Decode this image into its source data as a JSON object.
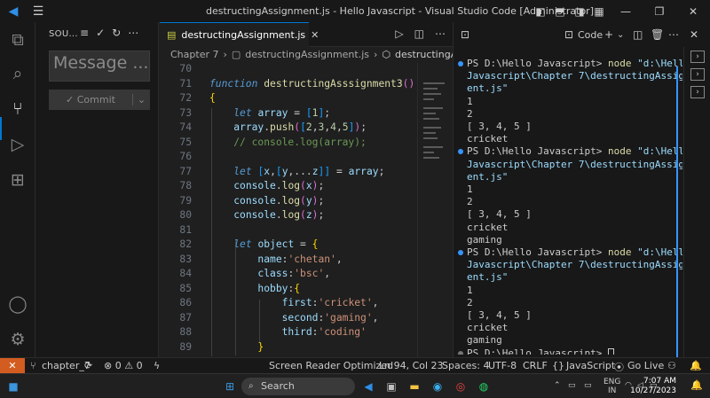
{
  "window": {
    "title": "destructingAssignment.js - Hello Javascript - Visual Studio Code [Administrator]"
  },
  "sidebar": {
    "header": "SOU...",
    "message_placeholder": "Message ...",
    "commit_label": "✓ Commit"
  },
  "editor": {
    "tab_label": "destructingAssignment.js",
    "breadcrumb": [
      "Chapter 7",
      "destructingAssignment.js",
      "destructingAsssignm"
    ],
    "line_numbers": [
      "70",
      "71",
      "72",
      "73",
      "74",
      "75",
      "76",
      "77",
      "78",
      "79",
      "80",
      "81",
      "82",
      "83",
      "84",
      "85",
      "86",
      "87",
      "88",
      "89"
    ],
    "code": [
      "",
      "function destructingAsssignment3()",
      "{",
      "    let array = [1];",
      "    array.push([2,3,4,5]);",
      "    // console.log(array);",
      "",
      "    let [x,[y,...z]] = array;",
      "    console.log(x);",
      "    console.log(y);",
      "    console.log(z);",
      "",
      "    let object = {",
      "        name:'chetan',",
      "        class:'bsc',",
      "        hobby:{",
      "            first:'cricket',",
      "            second:'gaming',",
      "            third:'coding'",
      "        }"
    ]
  },
  "terminal": {
    "shell_label": "Code",
    "output": [
      {
        "type": "cmd",
        "prompt": "PS D:\\Hello Javascript> ",
        "cmd": "node",
        "arg": " \"d:\\Hello"
      },
      {
        "type": "cont",
        "text": "Javascript\\Chapter 7\\destructingAssignm"
      },
      {
        "type": "cont",
        "text": "ent.js\""
      },
      {
        "type": "out",
        "text": "1"
      },
      {
        "type": "out",
        "text": "2"
      },
      {
        "type": "out",
        "text": "[ 3, 4, 5 ]"
      },
      {
        "type": "out",
        "text": "cricket"
      },
      {
        "type": "cmd",
        "prompt": "PS D:\\Hello Javascript> ",
        "cmd": "node",
        "arg": " \"d:\\Hello"
      },
      {
        "type": "cont",
        "text": "Javascript\\Chapter 7\\destructingAssignm"
      },
      {
        "type": "cont",
        "text": "ent.js\""
      },
      {
        "type": "out",
        "text": "1"
      },
      {
        "type": "out",
        "text": "2"
      },
      {
        "type": "out",
        "text": "[ 3, 4, 5 ]"
      },
      {
        "type": "out",
        "text": "cricket"
      },
      {
        "type": "out",
        "text": "gaming"
      },
      {
        "type": "cmd",
        "prompt": "PS D:\\Hello Javascript> ",
        "cmd": "node",
        "arg": " \"d:\\Hello"
      },
      {
        "type": "cont",
        "text": "Javascript\\Chapter 7\\destructingAssignm"
      },
      {
        "type": "cont",
        "text": "ent.js\""
      },
      {
        "type": "out",
        "text": "1"
      },
      {
        "type": "out",
        "text": "2"
      },
      {
        "type": "out",
        "text": "[ 3, 4, 5 ]"
      },
      {
        "type": "out",
        "text": "cricket"
      },
      {
        "type": "out",
        "text": "gaming"
      },
      {
        "type": "prompt",
        "prompt": "PS D:\\Hello Javascript> "
      }
    ]
  },
  "status": {
    "branch": "chapter_7",
    "problems": "⊗ 0 ⚠ 0",
    "screen_reader": "Screen Reader Optimized",
    "position": "Ln 94, Col 23",
    "spaces": "Spaces: 4",
    "encoding": "UTF-8",
    "eol": "CRLF",
    "language": "JavaScript",
    "golive": "Go Live"
  },
  "taskbar": {
    "search_label": "Search",
    "lang": "ENG",
    "region": "IN",
    "time": "7:07 AM",
    "date": "10/27/2023"
  },
  "colors": {
    "accent": "#0078d4",
    "remote": "#d35c20",
    "keyword": "#569cd6",
    "function": "#dcdcaa",
    "string": "#ce9178",
    "comment": "#6a9955"
  }
}
